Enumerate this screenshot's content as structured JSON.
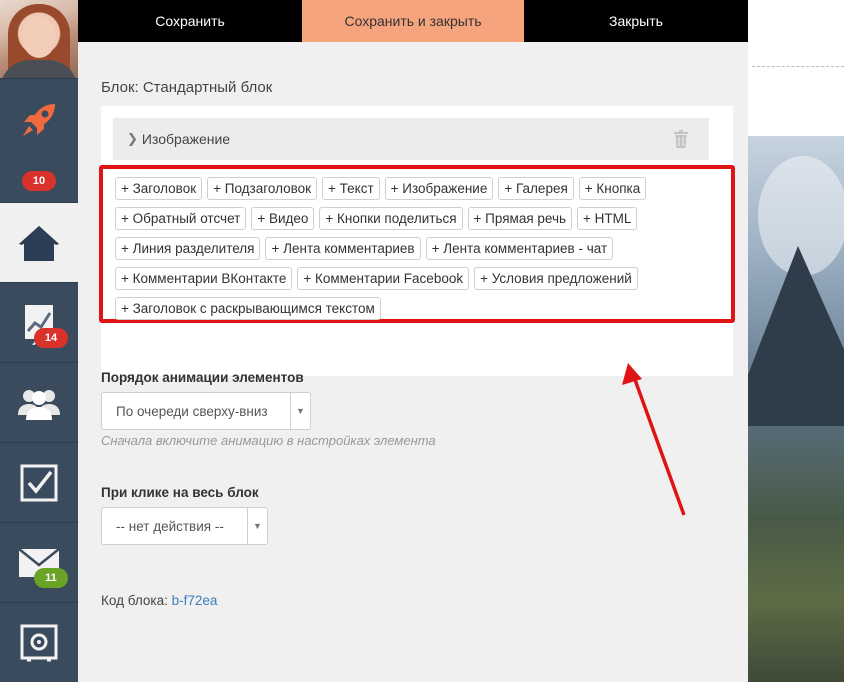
{
  "sidebar": {
    "badges": {
      "rocket": "10",
      "chart": "14",
      "mail": "11"
    }
  },
  "toolbar": {
    "save": "Сохранить",
    "save_close": "Сохранить и закрыть",
    "close": "Закрыть"
  },
  "editor": {
    "block_title": "Блок: Стандартный блок",
    "image_row_label": "Изображение",
    "elements": [
      "+ Заголовок",
      "+ Подзаголовок",
      "+ Текст",
      "+ Изображение",
      "+ Галерея",
      "+ Кнопка",
      "+ Обратный отсчет",
      "+ Видео",
      "+ Кнопки поделиться",
      "+ Прямая речь",
      "+ HTML",
      "+ Линия разделителя",
      "+ Лента комментариев",
      "+ Лента комментариев - чат",
      "+ Комментарии ВКонтакте",
      "+ Комментарии Facebook",
      "+ Условия предложений",
      "+ Заголовок с раскрывающимся текстом"
    ],
    "animation_label": "Порядок анимации элементов",
    "animation_value": "По очереди сверху-вниз",
    "animation_hint": "Сначала включите анимацию в настройках элемента",
    "click_label": "При клике на весь блок",
    "click_value": "-- нет действия --",
    "code_label": "Код блока: ",
    "code_value": "b-f72ea"
  },
  "colors": {
    "sidebar": "#3a4b5e",
    "accent": "#f6a47e",
    "highlight": "#e01414",
    "link": "#3a7dbb"
  }
}
